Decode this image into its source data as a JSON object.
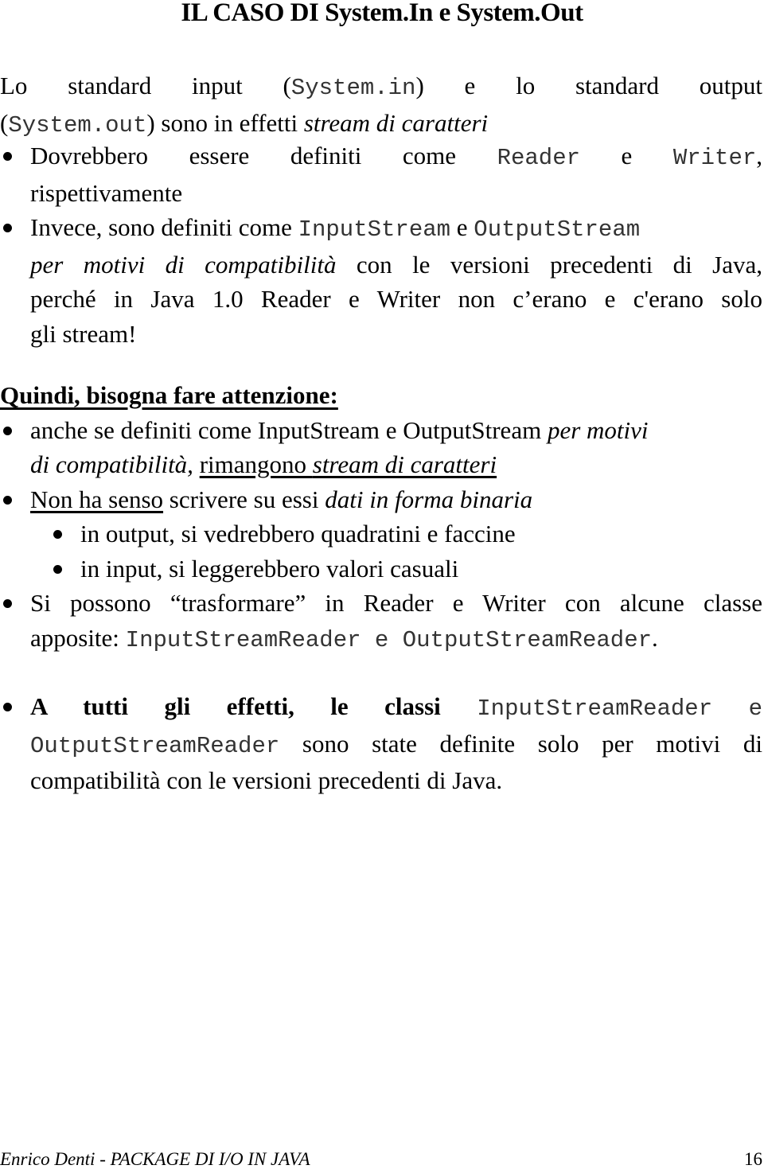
{
  "title": "IL CASO DI System.In e System.Out",
  "intro": {
    "line1": [
      "Lo",
      "standard",
      "input",
      "(",
      "System.in",
      ")",
      "e",
      "lo",
      "standard",
      "output"
    ],
    "t_lo": "Lo standard input (",
    "code_in": "System.in",
    "t_mid": ") e lo standard output",
    "open_paren": "(",
    "code_out": "System.out",
    "t_after_out": ") sono in effetti ",
    "italic_stream": "stream di caratteri"
  },
  "bullets1": [
    {
      "t1": "Dovrebbero essere definiti come ",
      "code_reader": "Reader",
      "t_e": " e ",
      "code_writer": "Writer",
      "t_comma": ",",
      "t2": "rispettivamente"
    },
    {
      "t1": "Invece, sono definiti come ",
      "code_is": "InputStream",
      "t_e": " e ",
      "code_os": "OutputStream",
      "italic_motivi": "per motivi di compatibilità",
      "t2": " con le versioni precedenti di Java,",
      "t3": "perché in Java 1.0 Reader e Writer non c’erano e c'erano solo",
      "t4": "gli stream!"
    }
  ],
  "section": {
    "heading": "Quindi, bisogna fare attenzione:",
    "items": [
      {
        "t1": "anche se definiti come InputStream e OutputStream ",
        "italic1": "per motivi",
        "italic2": "di compatibilità,",
        "sp": " ",
        "u_rimangono": "rimangono ",
        "u_italic_stream": "stream di caratteri"
      },
      {
        "u_non": "Non ha senso",
        "t1": " scrivere su essi ",
        "italic_dati": "dati in forma binaria",
        "subitems": [
          "in output, si vedrebbero quadratini e faccine",
          "in input, si leggerebbero valori casuali"
        ]
      },
      {
        "t1": "Si possono “trasformare” in Reader e Writer con alcune classe",
        "t2": "apposite: ",
        "code_isr": "InputStreamReader",
        "t_e": " e ",
        "code_osr": "OutputStreamReader",
        "t_dot": "."
      }
    ]
  },
  "final_bullet": {
    "bold": "A tutti gli effetti, le classi",
    "code_isr": "InputStreamReader",
    "t_e": "e",
    "code_osr": "OutputStreamReader",
    "t1": " sono state definite solo per motivi di",
    "t2": "compatibilità con le versioni precedenti di Java."
  },
  "footer": {
    "left": "Enrico Denti - PACKAGE DI I/O IN JAVA",
    "page_number": "16"
  }
}
